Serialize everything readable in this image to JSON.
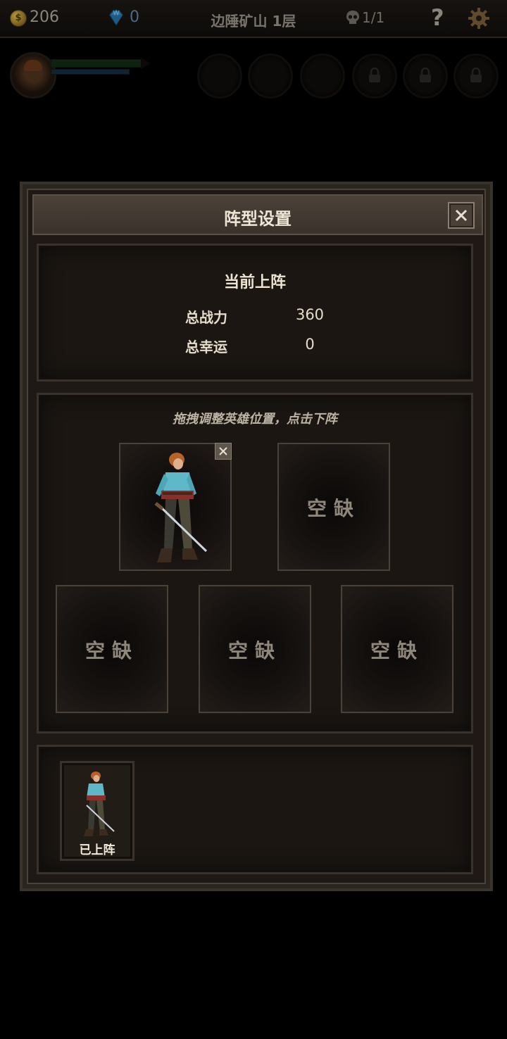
{
  "hud": {
    "coins": "206",
    "coin_symbol": "$",
    "gems": "0",
    "level_title": "边陲矿山 1层",
    "skull_count": "1/1",
    "help_symbol": "?"
  },
  "dialog": {
    "title": "阵型设置",
    "stats": {
      "title": "当前上阵",
      "power_label": "总战力",
      "power_value": "360",
      "luck_label": "总幸运",
      "luck_value": "0"
    },
    "formation": {
      "hint": "拖拽调整英雄位置，点击下阵",
      "empty_label": "空缺",
      "slots": [
        {
          "label": ""
        },
        {
          "label": "空缺"
        },
        {
          "label": "空缺"
        },
        {
          "label": "空缺"
        },
        {
          "label": "空缺"
        }
      ]
    },
    "roster": {
      "items": [
        {
          "status": "已上阵"
        }
      ]
    }
  },
  "colors": {
    "accent_shirt": "#5fb8c8",
    "hp_bar": "#1e4f22",
    "mp_bar": "#234e6a"
  }
}
